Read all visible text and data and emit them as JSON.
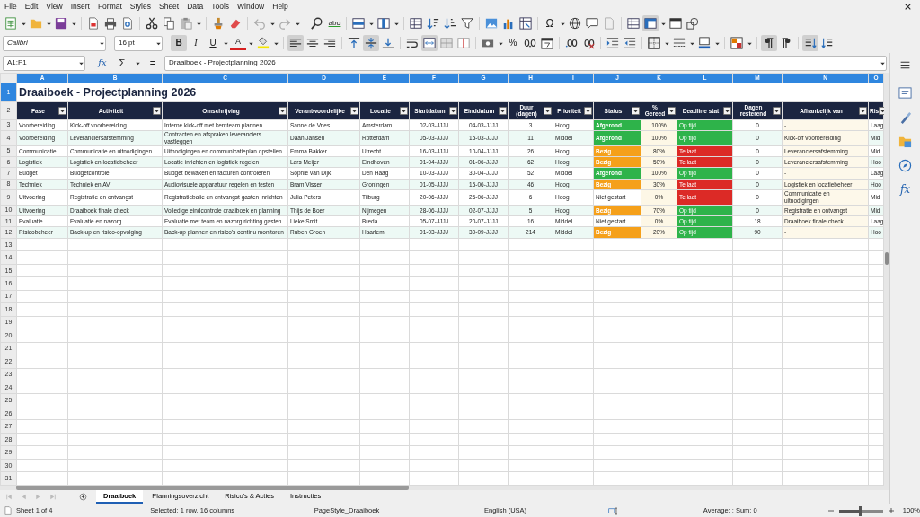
{
  "menu": [
    "File",
    "Edit",
    "View",
    "Insert",
    "Format",
    "Styles",
    "Sheet",
    "Data",
    "Tools",
    "Window",
    "Help"
  ],
  "standard_toolbar": {
    "spelling_label": "abc",
    "special_character_label": "Ω",
    "freeze_on": true
  },
  "format_toolbar": {
    "font_name": "Calibri",
    "font_size": "16 pt",
    "bold": {
      "label": "B",
      "on": true
    },
    "italic": {
      "label": "I",
      "on": false
    },
    "underline": {
      "label": "U",
      "on": false
    },
    "font_color_label": "A",
    "percent_label": "%",
    "align_left_on": true,
    "align_center_on": false,
    "align_right_on": false,
    "align_top_on": false,
    "align_middle_on": true,
    "align_bottom_on": false,
    "merge_center_on": true,
    "left_to_right_on": true,
    "right_to_left_on": false,
    "vertical_text_on": true
  },
  "formula_bar": {
    "cell_reference": "A1:P1",
    "function_wizard_label": "fx",
    "sum_label": "Σ",
    "equals_label": "=",
    "content": "Draaiboek - Projectplanning 2026"
  },
  "sidebar": {
    "function_label": "fx"
  },
  "sheet": {
    "columns": [
      {
        "label": "A",
        "selected": true
      },
      {
        "label": "B",
        "selected": true
      },
      {
        "label": "C",
        "selected": true
      },
      {
        "label": "D",
        "selected": true
      },
      {
        "label": "E",
        "selected": true
      },
      {
        "label": "F",
        "selected": true
      },
      {
        "label": "G",
        "selected": true
      },
      {
        "label": "H",
        "selected": true
      },
      {
        "label": "I",
        "selected": true
      },
      {
        "label": "J",
        "selected": true
      },
      {
        "label": "K",
        "selected": true
      },
      {
        "label": "L",
        "selected": true
      },
      {
        "label": "M",
        "selected": true
      },
      {
        "label": "N",
        "selected": true
      },
      {
        "label": "O",
        "selected": true
      }
    ],
    "row_numbers": [
      {
        "label": "1",
        "selected": true
      },
      {
        "label": "2",
        "selected": false
      },
      {
        "label": "3",
        "selected": false
      },
      {
        "label": "4",
        "selected": false
      },
      {
        "label": "5",
        "selected": false
      },
      {
        "label": "6",
        "selected": false
      },
      {
        "label": "7",
        "selected": false
      },
      {
        "label": "8",
        "selected": false
      },
      {
        "label": "9",
        "selected": false
      },
      {
        "label": "10",
        "selected": false
      },
      {
        "label": "11",
        "selected": false
      },
      {
        "label": "12",
        "selected": false
      },
      {
        "label": "13",
        "selected": false
      },
      {
        "label": "14",
        "selected": false
      },
      {
        "label": "15",
        "selected": false
      },
      {
        "label": "16",
        "selected": false
      },
      {
        "label": "17",
        "selected": false
      },
      {
        "label": "18",
        "selected": false
      },
      {
        "label": "19",
        "selected": false
      },
      {
        "label": "20",
        "selected": false
      },
      {
        "label": "21",
        "selected": false
      },
      {
        "label": "22",
        "selected": false
      },
      {
        "label": "23",
        "selected": false
      },
      {
        "label": "24",
        "selected": false
      },
      {
        "label": "25",
        "selected": false
      },
      {
        "label": "26",
        "selected": false
      },
      {
        "label": "27",
        "selected": false
      },
      {
        "label": "28",
        "selected": false
      },
      {
        "label": "29",
        "selected": false
      },
      {
        "label": "30",
        "selected": false
      },
      {
        "label": "31",
        "selected": false
      }
    ],
    "title": "Draaiboek - Projectplanning 2026",
    "headers": [
      "Fase",
      "Activiteit",
      "Omschrijving",
      "Verantwoordelijke",
      "Locatie",
      "Startdatum",
      "Einddatum",
      "Duur (dagen)",
      "Prioriteit",
      "Status",
      "% Gereed",
      "Deadline stat",
      "Dagen resterend",
      "Afhankelijk van",
      "Ris"
    ],
    "rows": [
      {
        "cells": [
          "Voorbereiding",
          "Kick-off voorbereiding",
          "Interne kick-off met kernteam plannen",
          "Sanne de Vries",
          "Amsterdam",
          "02-03-JJJJ",
          "04-03-JJJJ",
          "3",
          "Hoog",
          "Afgerond",
          "100%",
          "Op tijd",
          "0",
          "-",
          "Laag"
        ],
        "status_cell": {
          "color": "#2eb34a"
        },
        "deadline_cell": {
          "color": "#2eb34a"
        }
      },
      {
        "cells": [
          "Voorbereiding",
          "Leveranciersafstemming",
          "Contracten en afspraken leveranciers vastleggen",
          "Daan Jansen",
          "Rotterdam",
          "05-03-JJJJ",
          "15-03-JJJJ",
          "11",
          "Middel",
          "Afgerond",
          "100%",
          "Op tijd",
          "0",
          "Kick-off voorbereiding",
          "Mid"
        ],
        "status_cell": {
          "color": "#2eb34a"
        },
        "deadline_cell": {
          "color": "#2eb34a"
        }
      },
      {
        "cells": [
          "Communicatie",
          "Communicatie en uitnodigingen",
          "Uitnodigingen en communicatieplan opstellen",
          "Emma Bakker",
          "Utrecht",
          "16-03-JJJJ",
          "10-04-JJJJ",
          "26",
          "Hoog",
          "Bezig",
          "80%",
          "Te laat",
          "0",
          "Leveranciersafstemming",
          "Mid"
        ],
        "status_cell": {
          "color": "#f5a01a"
        },
        "deadline_cell": {
          "color": "#dc2a26"
        }
      },
      {
        "cells": [
          "Logistiek",
          "Logistiek en locatiebeheer",
          "Locatie inrichten en logistiek regelen",
          "Lars Meijer",
          "Eindhoven",
          "01-04-JJJJ",
          "01-06-JJJJ",
          "62",
          "Hoog",
          "Bezig",
          "50%",
          "Te laat",
          "0",
          "Leveranciersafstemming",
          "Hoo"
        ],
        "status_cell": {
          "color": "#f5a01a"
        },
        "deadline_cell": {
          "color": "#dc2a26"
        }
      },
      {
        "cells": [
          "Budget",
          "Budgetcontrole",
          "Budget bewaken en facturen controleren",
          "Sophie van Dijk",
          "Den Haag",
          "10-03-JJJJ",
          "30-04-JJJJ",
          "52",
          "Middel",
          "Afgerond",
          "100%",
          "Op tijd",
          "0",
          "-",
          "Laag"
        ],
        "status_cell": {
          "color": "#2eb34a"
        },
        "deadline_cell": {
          "color": "#2eb34a"
        }
      },
      {
        "cells": [
          "Techniek",
          "Techniek en AV",
          "Audiovisuele apparatuur regelen en testen",
          "Bram Visser",
          "Groningen",
          "01-05-JJJJ",
          "15-06-JJJJ",
          "46",
          "Hoog",
          "Bezig",
          "30%",
          "Te laat",
          "0",
          "Logistiek en locatiebeheer",
          "Hoo"
        ],
        "status_cell": {
          "color": "#f5a01a"
        },
        "deadline_cell": {
          "color": "#dc2a26"
        }
      },
      {
        "cells": [
          "Uitvoering",
          "Registratie en ontvangst",
          "Registratiebalie en ontvangst gasten inrichten",
          "Julia Peters",
          "Tilburg",
          "20-06-JJJJ",
          "25-06-JJJJ",
          "6",
          "Hoog",
          "Niet gestart",
          "0%",
          "Te laat",
          "0",
          "Communicatie en uitnodigingen",
          "Mid"
        ],
        "deadline_cell": {
          "color": "#dc2a26"
        }
      },
      {
        "cells": [
          "Uitvoering",
          "Draaiboek finale check",
          "Volledige eindcontrole draaiboek en planning",
          "Thijs de Boer",
          "Nijmegen",
          "28-06-JJJJ",
          "02-07-JJJJ",
          "5",
          "Hoog",
          "Bezig",
          "70%",
          "Op tijd",
          "0",
          "Registratie en ontvangst",
          "Mid"
        ],
        "status_cell": {
          "color": "#f5a01a"
        },
        "deadline_cell": {
          "color": "#2eb34a"
        }
      },
      {
        "cells": [
          "Evaluatie",
          "Evaluatie en nazorg",
          "Evaluatie met team en nazorg richting gasten",
          "Lieke Smit",
          "Breda",
          "05-07-JJJJ",
          "20-07-JJJJ",
          "16",
          "Middel",
          "Niet gestart",
          "0%",
          "Op tijd",
          "18",
          "Draaiboek finale check",
          "Laag"
        ],
        "deadline_cell": {
          "color": "#2eb34a"
        }
      },
      {
        "cells": [
          "Risicobeheer",
          "Back-up en risico-opvolging",
          "Back-up plannen en risico's continu monitoren",
          "Ruben Groen",
          "Haarlem",
          "01-03-JJJJ",
          "30-09-JJJJ",
          "214",
          "Middel",
          "Bezig",
          "20%",
          "Op tijd",
          "90",
          "-",
          "Hoo"
        ],
        "status_cell": {
          "color": "#f5a01a"
        },
        "deadline_cell": {
          "color": "#2eb34a"
        }
      }
    ]
  },
  "sheet_tabs": {
    "navigation_disabled": true,
    "tabs": [
      {
        "label": "Draaiboek",
        "selected": true
      },
      {
        "label": "Planningsoverzicht",
        "selected": false
      },
      {
        "label": "Risico's & Acties",
        "selected": false
      },
      {
        "label": "Instructies",
        "selected": false
      }
    ]
  },
  "status_bar": {
    "sheet_position": "Sheet 1 of 4",
    "selection": "Selected: 1 row, 16 columns",
    "page_style": "PageStyle_Draaiboek",
    "language": "English (USA)",
    "summary": "Average: ; Sum: 0",
    "zoom": {
      "level": 0.5,
      "reading": "100%"
    }
  }
}
